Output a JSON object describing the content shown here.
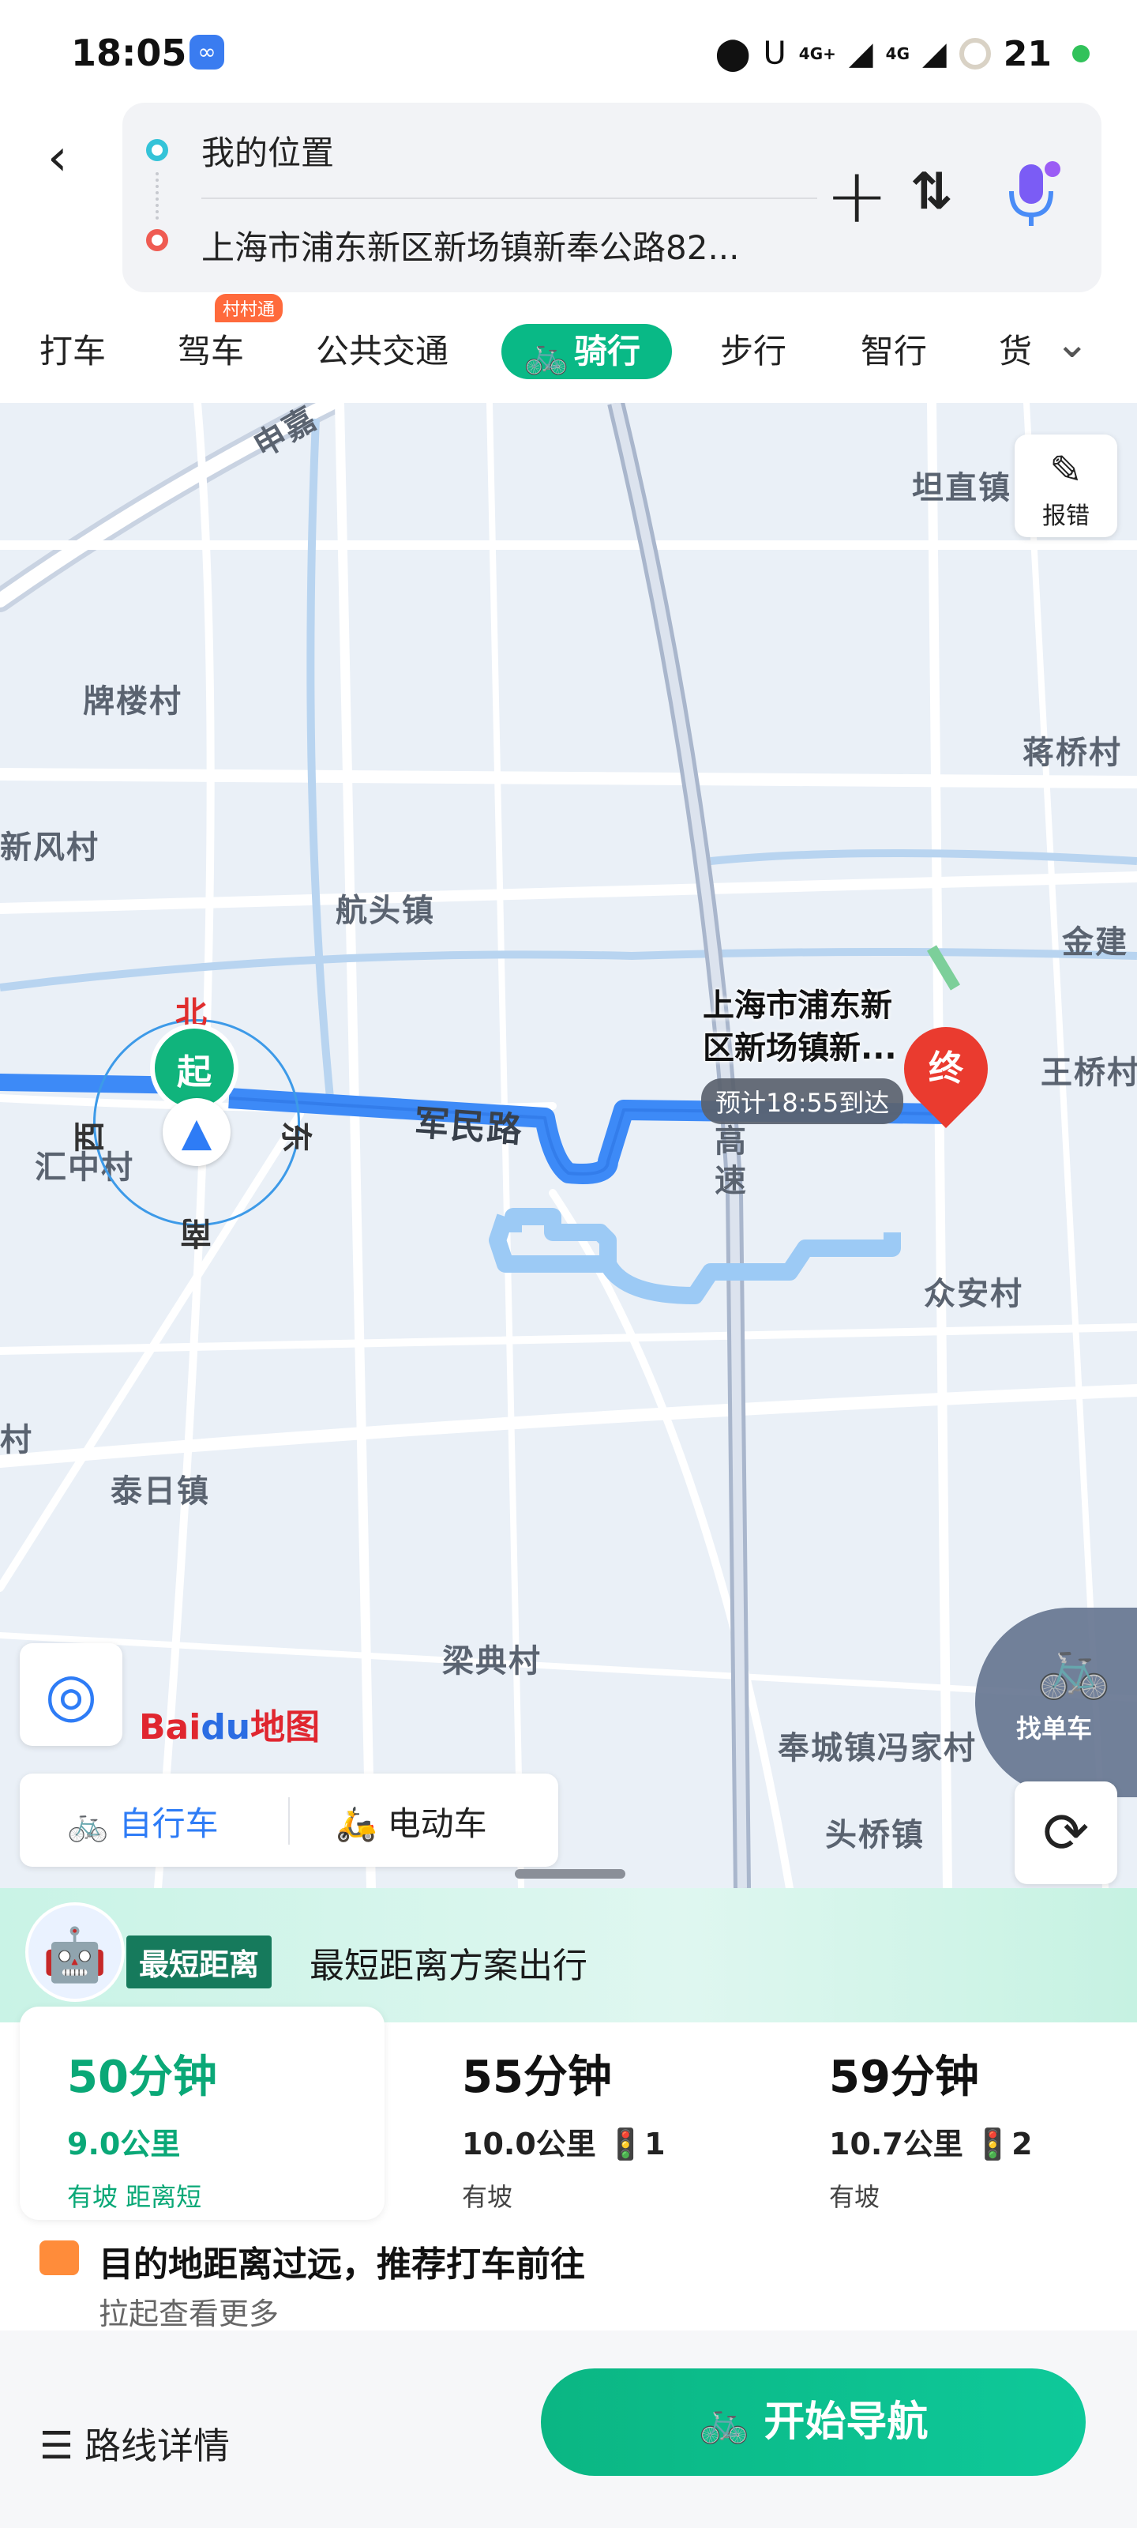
{
  "status_bar": {
    "time": "18:05",
    "net1": "4G+",
    "net2": "4G",
    "battery": "21"
  },
  "route": {
    "from": "我的位置",
    "to": "上海市浦东新区新场镇新奉公路82..."
  },
  "tabs": [
    "打车",
    "驾车",
    "公共交通",
    "骑行",
    "步行",
    "智行",
    "货"
  ],
  "tab_tag": "村村通",
  "map": {
    "report": "报错",
    "places": {
      "p1": "坦直镇",
      "p2": "牌楼村",
      "p3": "蒋桥村",
      "p4": "新风村",
      "p5": "航头镇",
      "p6": "金建",
      "p7": "王桥村",
      "p8": "汇中村",
      "p9": "众安村",
      "p10": "泰日镇",
      "p11": "村",
      "p12": "梁典村",
      "p13": "奉城镇冯家村",
      "p14": "头桥镇",
      "road1": "军民路",
      "road2": "申嘉",
      "highway": "高速"
    },
    "compass": {
      "north": "北",
      "east": "东",
      "south": "南",
      "west": "西"
    },
    "start_marker": "起",
    "end_marker": "终",
    "destination_label_1": "上海市浦东新",
    "destination_label_2": "区新场镇新...",
    "eta": "预计18:55到达",
    "logo_a": "Bai",
    "logo_b": "du",
    "logo_c": "地图",
    "find_bike": "找单车",
    "vehicle_options": [
      "自行车",
      "电动车"
    ]
  },
  "sheet": {
    "badge": "最短距离",
    "banner_text": "最短距离方案出行",
    "options": [
      {
        "time": "50分钟",
        "distance": "9.0公里",
        "lights": "",
        "tags": "有坡 距离短"
      },
      {
        "time": "55分钟",
        "distance": "10.0公里",
        "lights": "1",
        "tags": "有坡"
      },
      {
        "time": "59分钟",
        "distance": "10.7公里",
        "lights": "2",
        "tags": "有坡"
      }
    ],
    "tip_title": "目的地距离过远，推荐打车前往",
    "tip_sub": "拉起查看更多"
  },
  "bottom": {
    "detail": "路线详情",
    "start": "开始导航"
  },
  "colors": {
    "accent": "#09b986",
    "route": "#3d8af7",
    "end_pin": "#ea3b2f"
  }
}
